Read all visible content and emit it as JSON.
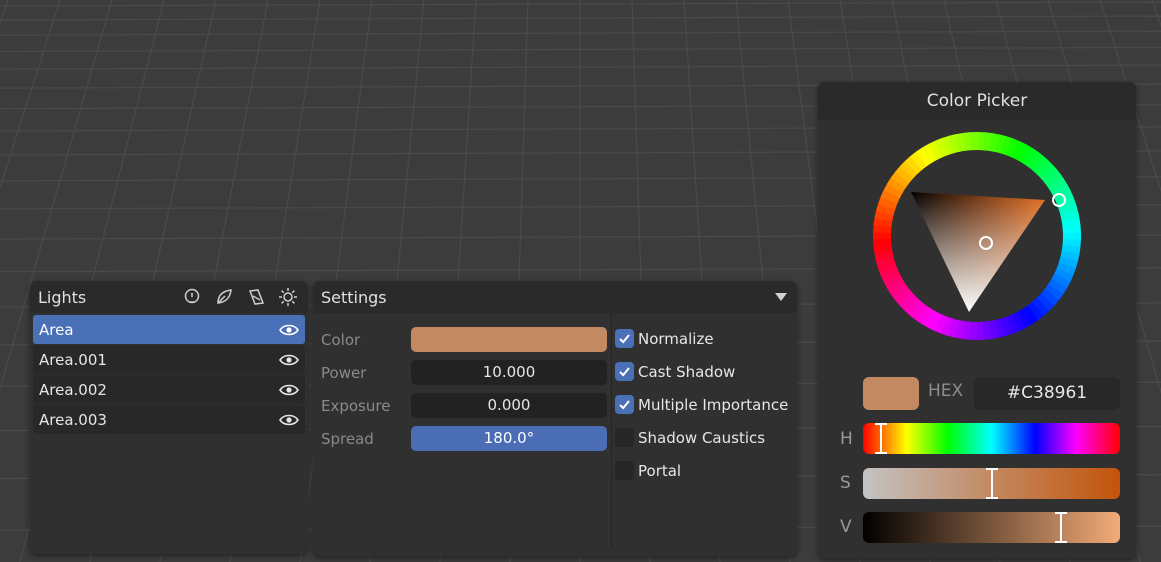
{
  "lights_panel": {
    "title": "Lights",
    "header_icons": [
      "light-probe-icon",
      "leaf-icon",
      "shade-icon",
      "sun-icon"
    ],
    "items": [
      {
        "label": "Area",
        "active": true,
        "icon": "eye-icon"
      },
      {
        "label": "Area.001",
        "active": false,
        "icon": "eye-icon"
      },
      {
        "label": "Area.002",
        "active": false,
        "icon": "eye-icon"
      },
      {
        "label": "Area.003",
        "active": false,
        "icon": "eye-icon"
      }
    ]
  },
  "settings_panel": {
    "title": "Settings",
    "properties": {
      "color_label": "Color",
      "power_label": "Power",
      "power_value": "10.000",
      "exposure_label": "Exposure",
      "exposure_value": "0.000",
      "spread_label": "Spread",
      "spread_value": "180.0°"
    },
    "checkboxes": [
      {
        "label": "Normalize",
        "checked": true
      },
      {
        "label": "Cast Shadow",
        "checked": true
      },
      {
        "label": "Multiple Importance",
        "checked": true
      },
      {
        "label": "Shadow Caustics",
        "checked": false
      },
      {
        "label": "Portal",
        "checked": false
      }
    ]
  },
  "color_picker": {
    "title": "Color Picker",
    "hex_label": "HEX",
    "hex_value": "#C38961",
    "channels": {
      "h_label": "H",
      "s_label": "S",
      "v_label": "V"
    },
    "hue_fraction": 0.07,
    "saturation_fraction": 0.5,
    "value_fraction": 0.77,
    "color": "#c38961"
  }
}
